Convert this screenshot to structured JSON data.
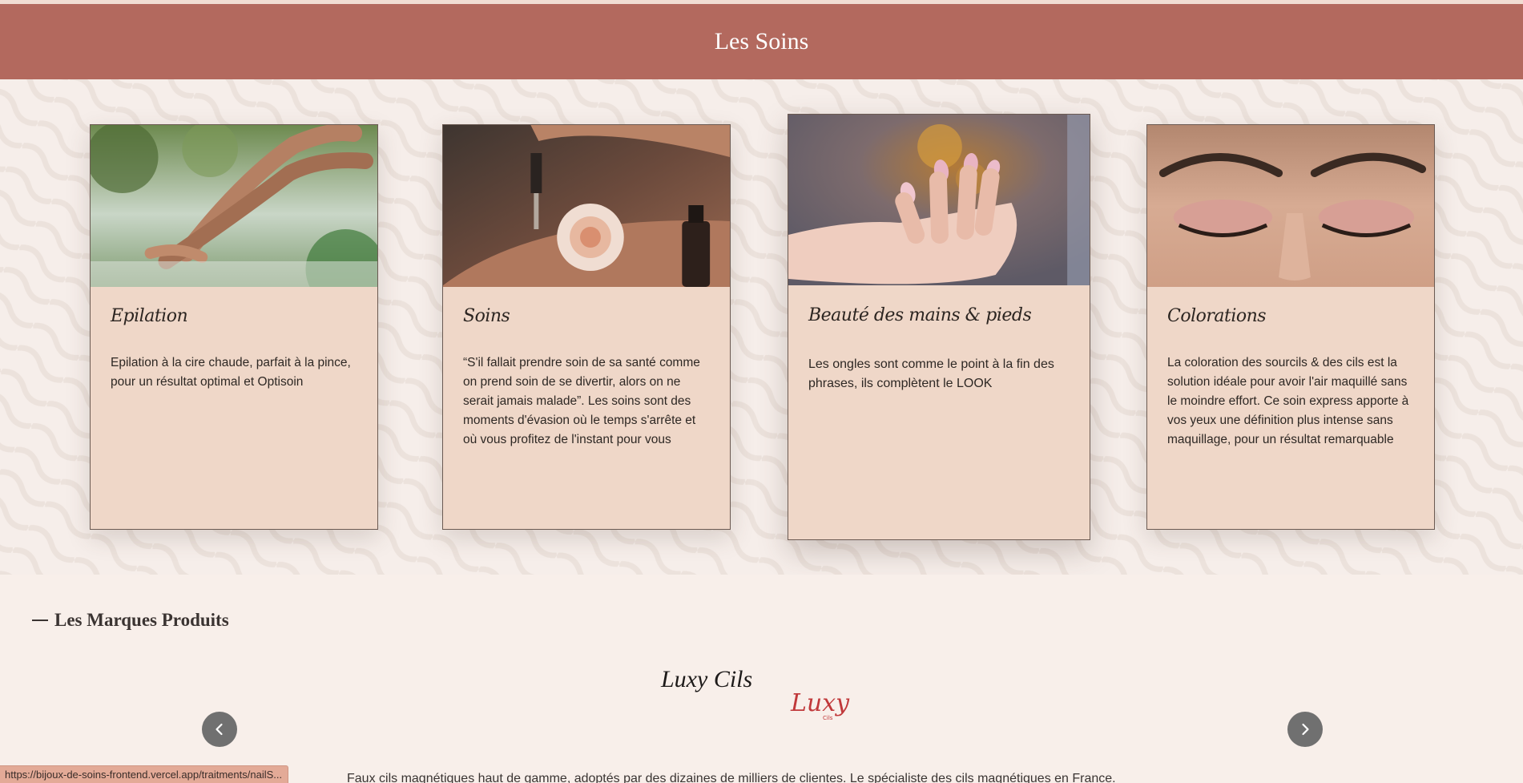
{
  "banner": {
    "title": "Les Soins"
  },
  "cards": [
    {
      "title": "Epilation",
      "text": "Epilation à la cire chaude, parfait à la pince, pour un résultat optimal et Optisoin",
      "image_icon": "legs-photo"
    },
    {
      "title": "Soins",
      "text": "“S'il fallait prendre soin de sa santé comme on prend soin de se divertir, alors on ne serait jamais malade”. Les soins sont des moments d'évasion où le temps s'arrête et où vous profitez de l'instant pour vous",
      "image_icon": "rose-dropper-photo"
    },
    {
      "title": "Beauté des mains & pieds",
      "text": "Les ongles sont comme le point à la fin des phrases, ils complètent le LOOK",
      "image_icon": "manicure-photo"
    },
    {
      "title": "Colorations",
      "text": "La coloration des sourcils & des cils est la solution idéale pour avoir l'air maquillé sans le moindre effort. Ce soin express apporte à vos yeux une définition plus intense sans maquillage, pour un résultat remarquable",
      "image_icon": "closed-eyes-photo"
    }
  ],
  "marques": {
    "heading": "Les Marques Produits",
    "brand_name": "Luxy Cils",
    "logo_text": "Luxy",
    "logo_subtext": "Cils",
    "description": "Faux cils magnétiques haut de gamme, adoptés par des dizaines de milliers de clientes. Le spécialiste des cils magnétiques en France.",
    "prev_icon": "chevron-left-icon",
    "next_icon": "chevron-right-icon"
  },
  "status_bar": {
    "url": "https://bijoux-de-soins-frontend.vercel.app/traitments/nailS..."
  },
  "colors": {
    "banner": "#b3695e",
    "card_bg": "#efd7c8",
    "page_bg": "#f8efea",
    "nav_button": "#707070",
    "logo_red": "#c0383a",
    "status_bg": "#e3aa97"
  }
}
